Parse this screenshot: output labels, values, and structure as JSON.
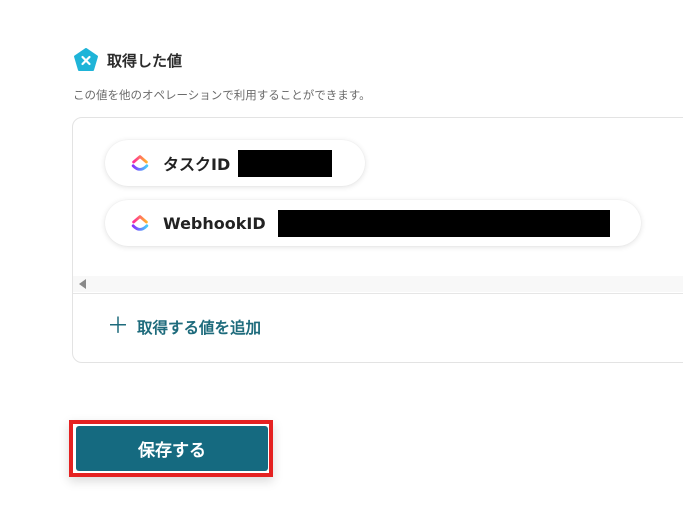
{
  "section": {
    "title": "取得した値",
    "description": "この値を他のオペレーションで利用することができます。"
  },
  "chips": [
    {
      "label": "タスクID",
      "value_redacted": true
    },
    {
      "label": "WebhookID",
      "value_redacted": true
    }
  ],
  "add_value_label": "取得する値を追加",
  "save_label": "保存する",
  "colors": {
    "accent": "#156a80",
    "icon_cyan": "#1fb4d8",
    "highlight_border": "#e52222"
  }
}
